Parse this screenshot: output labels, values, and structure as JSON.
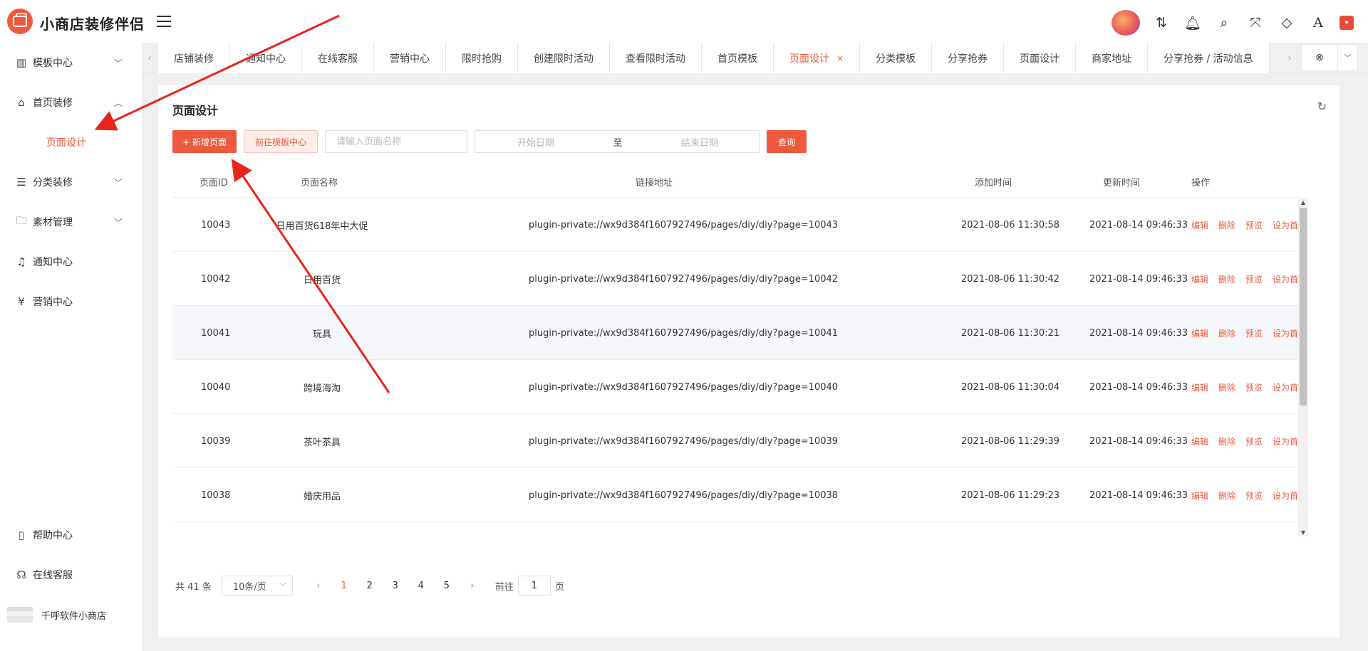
{
  "app": {
    "brand": "小商店装修伴侣"
  },
  "sidebar": {
    "items": [
      {
        "label": "模板中心",
        "icon": "layout-icon"
      },
      {
        "label": "首页装修",
        "icon": "home-decor-icon"
      },
      {
        "label": "页面设计",
        "icon": ""
      },
      {
        "label": "分类装修",
        "icon": "list-icon"
      },
      {
        "label": "素材管理",
        "icon": "folder-icon"
      },
      {
        "label": "通知中心",
        "icon": "bell-icon"
      },
      {
        "label": "营销中心",
        "icon": "marketing-icon"
      }
    ],
    "bottom": [
      {
        "label": "帮助中心",
        "icon": "book-icon"
      },
      {
        "label": "在线客服",
        "icon": "headset-icon"
      },
      {
        "label": "千呼软件小商店",
        "icon": "shop-logo-icon"
      }
    ]
  },
  "tabs": [
    {
      "label": "店铺装修"
    },
    {
      "label": "通知中心"
    },
    {
      "label": "在线客服"
    },
    {
      "label": "营销中心"
    },
    {
      "label": "限时抢购"
    },
    {
      "label": "创建限时活动"
    },
    {
      "label": "查看限时活动"
    },
    {
      "label": "首页模板"
    },
    {
      "label": "页面设计",
      "close": "×"
    },
    {
      "label": "分类模板"
    },
    {
      "label": "分享抢券"
    },
    {
      "label": "页面设计"
    },
    {
      "label": "商家地址"
    },
    {
      "label": "分享抢券 / 活动信息"
    }
  ],
  "panel": {
    "title": "页面设计",
    "new_page_label": "+ 新增页面",
    "goto_template_label": "前往模板中心",
    "name_placeholder": "请输入页面名称",
    "start_date_placeholder": "开始日期",
    "date_separator": "至",
    "end_date_placeholder": "结束日期",
    "query_label": "查询"
  },
  "table": {
    "headers": [
      "页面ID",
      "页面名称",
      "链接地址",
      "添加时间",
      "更新时间",
      "操作"
    ],
    "rows": [
      {
        "id": "10043",
        "name": "日用百货618年中大促",
        "url": "plugin-private://wx9d384f1607927496/pages/diy/diy?page=10043",
        "added": "2021-08-06 11:30:58",
        "updated": "2021-08-14 09:46:33"
      },
      {
        "id": "10042",
        "name": "日用百货",
        "url": "plugin-private://wx9d384f1607927496/pages/diy/diy?page=10042",
        "added": "2021-08-06 11:30:42",
        "updated": "2021-08-14 09:46:33"
      },
      {
        "id": "10041",
        "name": "玩具",
        "url": "plugin-private://wx9d384f1607927496/pages/diy/diy?page=10041",
        "added": "2021-08-06 11:30:21",
        "updated": "2021-08-14 09:46:33"
      },
      {
        "id": "10040",
        "name": "跨境海淘",
        "url": "plugin-private://wx9d384f1607927496/pages/diy/diy?page=10040",
        "added": "2021-08-06 11:30:04",
        "updated": "2021-08-14 09:46:33"
      },
      {
        "id": "10039",
        "name": "茶叶茶具",
        "url": "plugin-private://wx9d384f1607927496/pages/diy/diy?page=10039",
        "added": "2021-08-06 11:29:39",
        "updated": "2021-08-14 09:46:33"
      },
      {
        "id": "10038",
        "name": "婚庆用品",
        "url": "plugin-private://wx9d384f1607927496/pages/diy/diy?page=10038",
        "added": "2021-08-06 11:29:23",
        "updated": "2021-08-14 09:46:33"
      }
    ],
    "ops": [
      "编辑",
      "删除",
      "预览",
      "设为首页"
    ]
  },
  "pagination": {
    "total": "共 41 条",
    "page_size": "10条/页",
    "pages": [
      "1",
      "2",
      "3",
      "4",
      "5"
    ],
    "current": "1",
    "goto_prefix": "前往",
    "goto_value": "1",
    "goto_suffix": "页"
  },
  "colors": {
    "accent": "#ef5a3f",
    "annotation_arrow": "#e8251c"
  }
}
